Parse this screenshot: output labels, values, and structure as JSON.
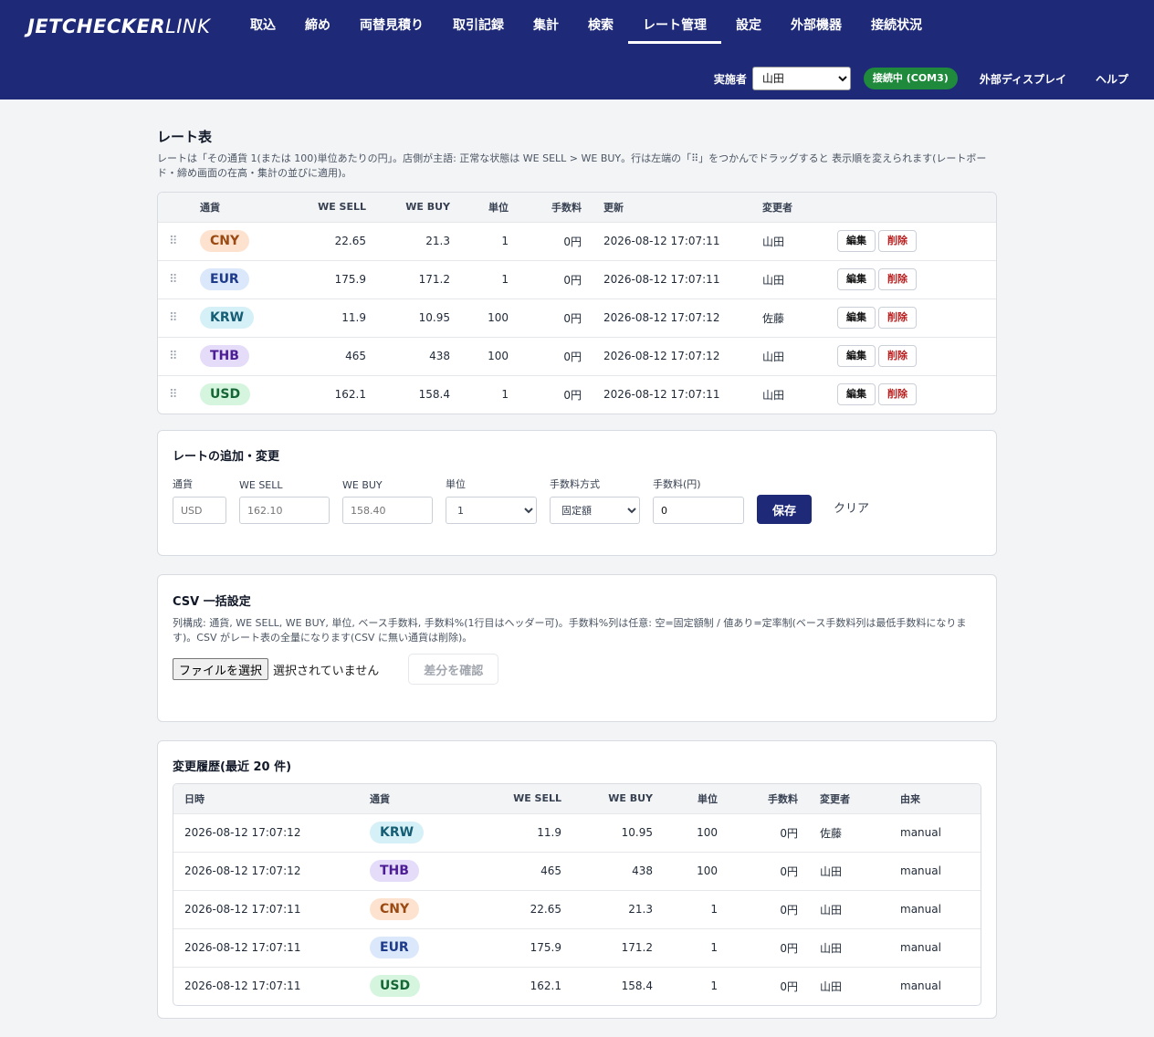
{
  "app": {
    "logo_bold": "JETCHECKER",
    "logo_thin": "LINK"
  },
  "nav": {
    "items": [
      "取込",
      "締め",
      "両替見積り",
      "取引記録",
      "集計",
      "検索",
      "レート管理",
      "設定",
      "外部機器",
      "接続状況"
    ],
    "active": "レート管理"
  },
  "subbar": {
    "operator_label": "実施者",
    "operator_value": "山田",
    "connection": "接続中 (COM3)",
    "external_display": "外部ディスプレイ",
    "help": "ヘルプ"
  },
  "colors": {
    "header_bg": "#1e2a78",
    "connected": "#1f8a3c",
    "danger": "#b91c1c"
  },
  "rate_table": {
    "title": "レート表",
    "desc": "レートは「その通貨 1(または 100)単位あたりの円」。店側が主語: 正常な状態は WE SELL > WE BUY。行は左端の「⠿」をつかんでドラッグすると 表示順を変えられます(レートボード・締め画面の在高・集計の並びに適用)。",
    "headers": [
      "通貨",
      "WE SELL",
      "WE BUY",
      "単位",
      "手数料",
      "更新",
      "変更者"
    ],
    "edit_label": "編集",
    "delete_label": "削除",
    "rows": [
      {
        "currency": "CNY",
        "sell": "22.65",
        "buy": "21.3",
        "unit": "1",
        "fee": "0円",
        "updated": "2026-08-12 17:07:11",
        "by": "山田"
      },
      {
        "currency": "EUR",
        "sell": "175.9",
        "buy": "171.2",
        "unit": "1",
        "fee": "0円",
        "updated": "2026-08-12 17:07:11",
        "by": "山田"
      },
      {
        "currency": "KRW",
        "sell": "11.9",
        "buy": "10.95",
        "unit": "100",
        "fee": "0円",
        "updated": "2026-08-12 17:07:12",
        "by": "佐藤"
      },
      {
        "currency": "THB",
        "sell": "465",
        "buy": "438",
        "unit": "100",
        "fee": "0円",
        "updated": "2026-08-12 17:07:12",
        "by": "山田"
      },
      {
        "currency": "USD",
        "sell": "162.1",
        "buy": "158.4",
        "unit": "1",
        "fee": "0円",
        "updated": "2026-08-12 17:07:11",
        "by": "山田"
      }
    ]
  },
  "currency_colors": {
    "CNY": {
      "bg": "#fde3cf",
      "fg": "#9a4a12"
    },
    "EUR": {
      "bg": "#dbe7fb",
      "fg": "#1e3a8a"
    },
    "KRW": {
      "bg": "#d5f0f6",
      "fg": "#155e75"
    },
    "THB": {
      "bg": "#e5dcf9",
      "fg": "#4c1d95"
    },
    "USD": {
      "bg": "#d6f5df",
      "fg": "#166534"
    }
  },
  "add_form": {
    "title": "レートの追加・変更",
    "currency_label": "通貨",
    "currency_placeholder": "USD",
    "sell_label": "WE SELL",
    "sell_placeholder": "162.10",
    "buy_label": "WE BUY",
    "buy_placeholder": "158.40",
    "unit_label": "単位",
    "unit_value": "1",
    "fee_method_label": "手数料方式",
    "fee_method_value": "固定額",
    "fee_label": "手数料(円)",
    "fee_value": "0",
    "save_label": "保存",
    "clear_label": "クリア"
  },
  "csv": {
    "title": "CSV 一括設定",
    "desc": "列構成: 通貨, WE SELL, WE BUY, 単位, ベース手数料, 手数料%(1行目はヘッダー可)。手数料%列は任意: 空=固定額制 / 値あり=定率制(ベース手数料列は最低手数料になります)。CSV がレート表の全量になります(CSV に無い通貨は削除)。",
    "file_button": "ファイルを選択",
    "file_none": "選択されていません",
    "diff_button": "差分を確認"
  },
  "history": {
    "title": "変更履歴(最近 20 件)",
    "headers": [
      "日時",
      "通貨",
      "WE SELL",
      "WE BUY",
      "単位",
      "手数料",
      "変更者",
      "由来"
    ],
    "rows": [
      {
        "time": "2026-08-12 17:07:12",
        "currency": "KRW",
        "sell": "11.9",
        "buy": "10.95",
        "unit": "100",
        "fee": "0円",
        "by": "佐藤",
        "source": "manual"
      },
      {
        "time": "2026-08-12 17:07:12",
        "currency": "THB",
        "sell": "465",
        "buy": "438",
        "unit": "100",
        "fee": "0円",
        "by": "山田",
        "source": "manual"
      },
      {
        "time": "2026-08-12 17:07:11",
        "currency": "CNY",
        "sell": "22.65",
        "buy": "21.3",
        "unit": "1",
        "fee": "0円",
        "by": "山田",
        "source": "manual"
      },
      {
        "time": "2026-08-12 17:07:11",
        "currency": "EUR",
        "sell": "175.9",
        "buy": "171.2",
        "unit": "1",
        "fee": "0円",
        "by": "山田",
        "source": "manual"
      },
      {
        "time": "2026-08-12 17:07:11",
        "currency": "USD",
        "sell": "162.1",
        "buy": "158.4",
        "unit": "1",
        "fee": "0円",
        "by": "山田",
        "source": "manual"
      }
    ]
  }
}
